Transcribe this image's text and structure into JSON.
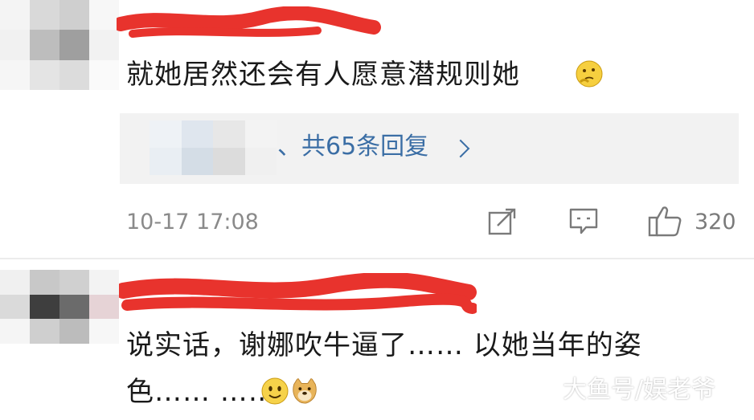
{
  "comments": [
    {
      "text": "就她居然还会有人愿意潜规则她",
      "emoji_icon": "thinking-face-icon",
      "reply_summary": "、共65条回复",
      "timestamp": "10-17 17:08",
      "like_count": "320",
      "actions": [
        "share-icon",
        "comment-icon",
        "like-icon"
      ]
    },
    {
      "text_line1": "说实话，谢娜吹牛逼了……  以她当年的姿",
      "text_line2": "色……  ……",
      "emoji_icons": [
        "smile-face-icon",
        "doge-icon"
      ]
    }
  ],
  "watermark": "大鱼号/娱老爷",
  "colors": {
    "link_blue": "#3b6ea5",
    "scribble_red": "#e8332d",
    "meta_gray": "#8a8a8a",
    "reply_bg": "#f2f2f2"
  }
}
